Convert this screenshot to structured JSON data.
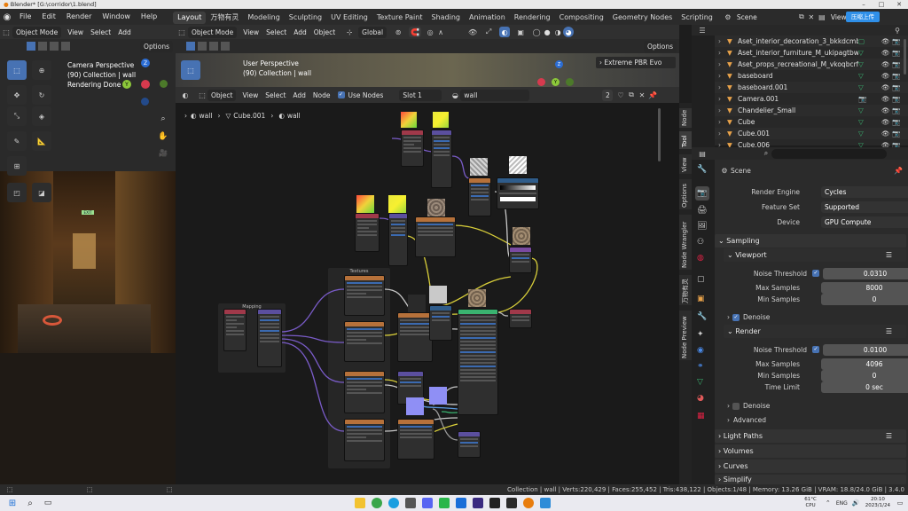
{
  "window": {
    "title": "Blender* [G:\\corridor\\1.blend]"
  },
  "menu": {
    "items": [
      "File",
      "Edit",
      "Render",
      "Window",
      "Help"
    ],
    "workspaces": [
      "Layout",
      "万物有灵",
      "Modeling",
      "Sculpting",
      "UV Editing",
      "Texture Paint",
      "Shading",
      "Animation",
      "Rendering",
      "Compositing",
      "Geometry Nodes",
      "Scripting"
    ],
    "active_workspace": "Layout",
    "scene": "Scene",
    "view_layer": "View L",
    "upload_button": "压缩上传"
  },
  "viewport_left": {
    "mode": "Object Mode",
    "menu": [
      "View",
      "Select",
      "Add"
    ],
    "options": "Options",
    "overlay_lines": [
      "Camera Perspective",
      "(90) Collection | wall",
      "Rendering Done"
    ],
    "gizmo_axes": [
      "Z",
      "Y"
    ],
    "camera_label": "EXIT"
  },
  "viewport_top": {
    "mode": "Object Mode",
    "menu": [
      "View",
      "Select",
      "Add",
      "Object"
    ],
    "transform": "Global",
    "options": "Options",
    "overlay_lines": [
      "User Perspective",
      "(90) Collection | wall"
    ],
    "banner": "Extreme PBR Evo"
  },
  "node_editor": {
    "editor_type": "Object",
    "menu": [
      "View",
      "Select",
      "Add",
      "Node"
    ],
    "use_nodes_label": "Use Nodes",
    "slot": "Slot 1",
    "material": "wall",
    "users": "2",
    "breadcrumb": [
      "wall",
      "Cube.001",
      "wall"
    ],
    "side_tabs": [
      "Node",
      "Tool",
      "View",
      "Options",
      "Node Wrangler",
      "万物有灵",
      "Node Preview"
    ],
    "frames": {
      "textures": "Textures",
      "mapping": "Mapping"
    }
  },
  "outliner": {
    "items": [
      {
        "name": "Aset_interior_decoration_3_bkkdcmbw_L",
        "icon": "collection-icon"
      },
      {
        "name": "Aset_interior_furniture_M_ukipagtbw_LOD",
        "icon": "mesh-icon"
      },
      {
        "name": "Aset_props_recreational_M_vkoqbcrfa_LO",
        "icon": "mesh-icon"
      },
      {
        "name": "baseboard",
        "icon": "mesh-icon"
      },
      {
        "name": "baseboard.001",
        "icon": "mesh-icon"
      },
      {
        "name": "Camera.001",
        "icon": "camera-icon"
      },
      {
        "name": "Chandelier_Small",
        "icon": "mesh-icon"
      },
      {
        "name": "Cube",
        "icon": "mesh-icon"
      },
      {
        "name": "Cube.001",
        "icon": "mesh-icon"
      },
      {
        "name": "Cube.006",
        "icon": "mesh-icon"
      }
    ]
  },
  "properties": {
    "scene": "Scene",
    "render_engine_label": "Render Engine",
    "render_engine": "Cycles",
    "feature_set_label": "Feature Set",
    "feature_set": "Supported",
    "device_label": "Device",
    "device": "GPU Compute",
    "sampling": "Sampling",
    "viewport": "Viewport",
    "noise_threshold_label": "Noise Threshold",
    "viewport_noise_threshold": "0.0310",
    "max_samples_label": "Max Samples",
    "viewport_max_samples": "8000",
    "min_samples_label": "Min Samples",
    "viewport_min_samples": "0",
    "denoise": "Denoise",
    "render": "Render",
    "render_noise_threshold": "0.0100",
    "render_max_samples": "4096",
    "render_min_samples": "0",
    "time_limit_label": "Time Limit",
    "time_limit": "0 sec",
    "advanced": "Advanced",
    "light_paths": "Light Paths",
    "volumes": "Volumes",
    "curves": "Curves",
    "simplify": "Simplify"
  },
  "status_bar": {
    "text": "Collection | wall | Verts:220,429 | Faces:255,452 | Tris:438,122 | Objects:1/48 | Memory: 13.26 GiB | VRAM: 18.8/24.0 GiB | 3.4.0"
  },
  "taskbar": {
    "weather": "61°C",
    "weather_sub": "CPU",
    "lang": "ENG",
    "time": "20:10",
    "date": "2023/1/24"
  },
  "colors": {
    "accent": "#4772b3",
    "header": "#303030",
    "background": "#1d1d1d"
  }
}
